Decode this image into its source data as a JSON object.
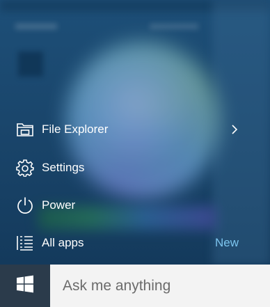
{
  "start_menu": {
    "items": [
      {
        "label": "File Explorer",
        "icon": "folder-icon",
        "has_chevron": true
      },
      {
        "label": "Settings",
        "icon": "gear-icon"
      },
      {
        "label": "Power",
        "icon": "power-icon"
      },
      {
        "label": "All apps",
        "icon": "list-icon",
        "badge": "New"
      }
    ]
  },
  "taskbar": {
    "start_icon": "windows-logo-icon",
    "search_placeholder": "Ask me anything"
  },
  "colors": {
    "menu_background": "#1a466c",
    "start_button": "#2b3b4b",
    "search_background": "#f3f3f3",
    "badge": "#7cc4ee",
    "text": "#ffffff"
  }
}
